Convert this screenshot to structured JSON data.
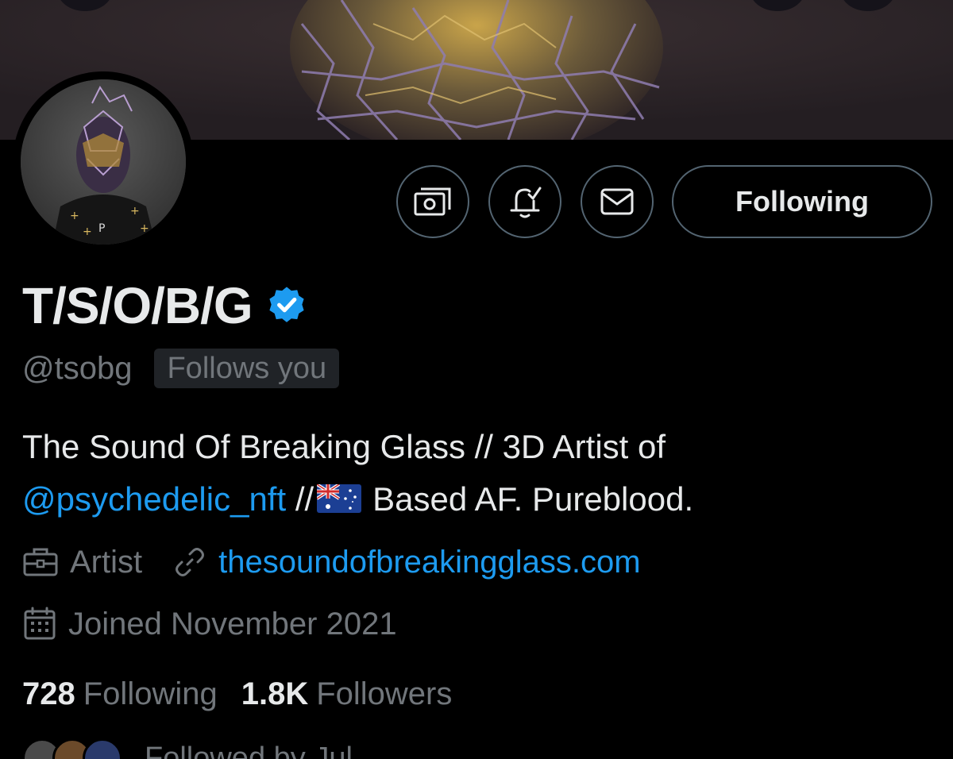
{
  "profile": {
    "display_name": "T/S/O/B/G",
    "handle": "@tsobg",
    "follows_you_badge": "Follows you",
    "verified_color": "#1d9bf0"
  },
  "actions": {
    "tip_icon": "money-icon",
    "notify_icon": "bell-check-icon",
    "message_icon": "envelope-icon",
    "following_label": "Following"
  },
  "bio": {
    "text_1": "The Sound Of Breaking Glass // 3D Artist of",
    "mention": "@psychedelic_nft",
    "text_2": " //",
    "flag": "australia-flag",
    "text_3": "Based AF. Pureblood."
  },
  "meta": {
    "category": "Artist",
    "website": "thesoundofbreakingglass.com",
    "joined": "Joined November 2021"
  },
  "stats": {
    "following_count": "728",
    "following_label": "Following",
    "followers_count": "1.8K",
    "followers_label": "Followers"
  },
  "followed_by": {
    "text": "Followed by Jul..."
  },
  "colors": {
    "background": "#000000",
    "text_primary": "#e7e9ea",
    "text_secondary": "#71767b",
    "accent": "#1d9bf0",
    "border": "#536471",
    "banner": "#2a2226"
  }
}
